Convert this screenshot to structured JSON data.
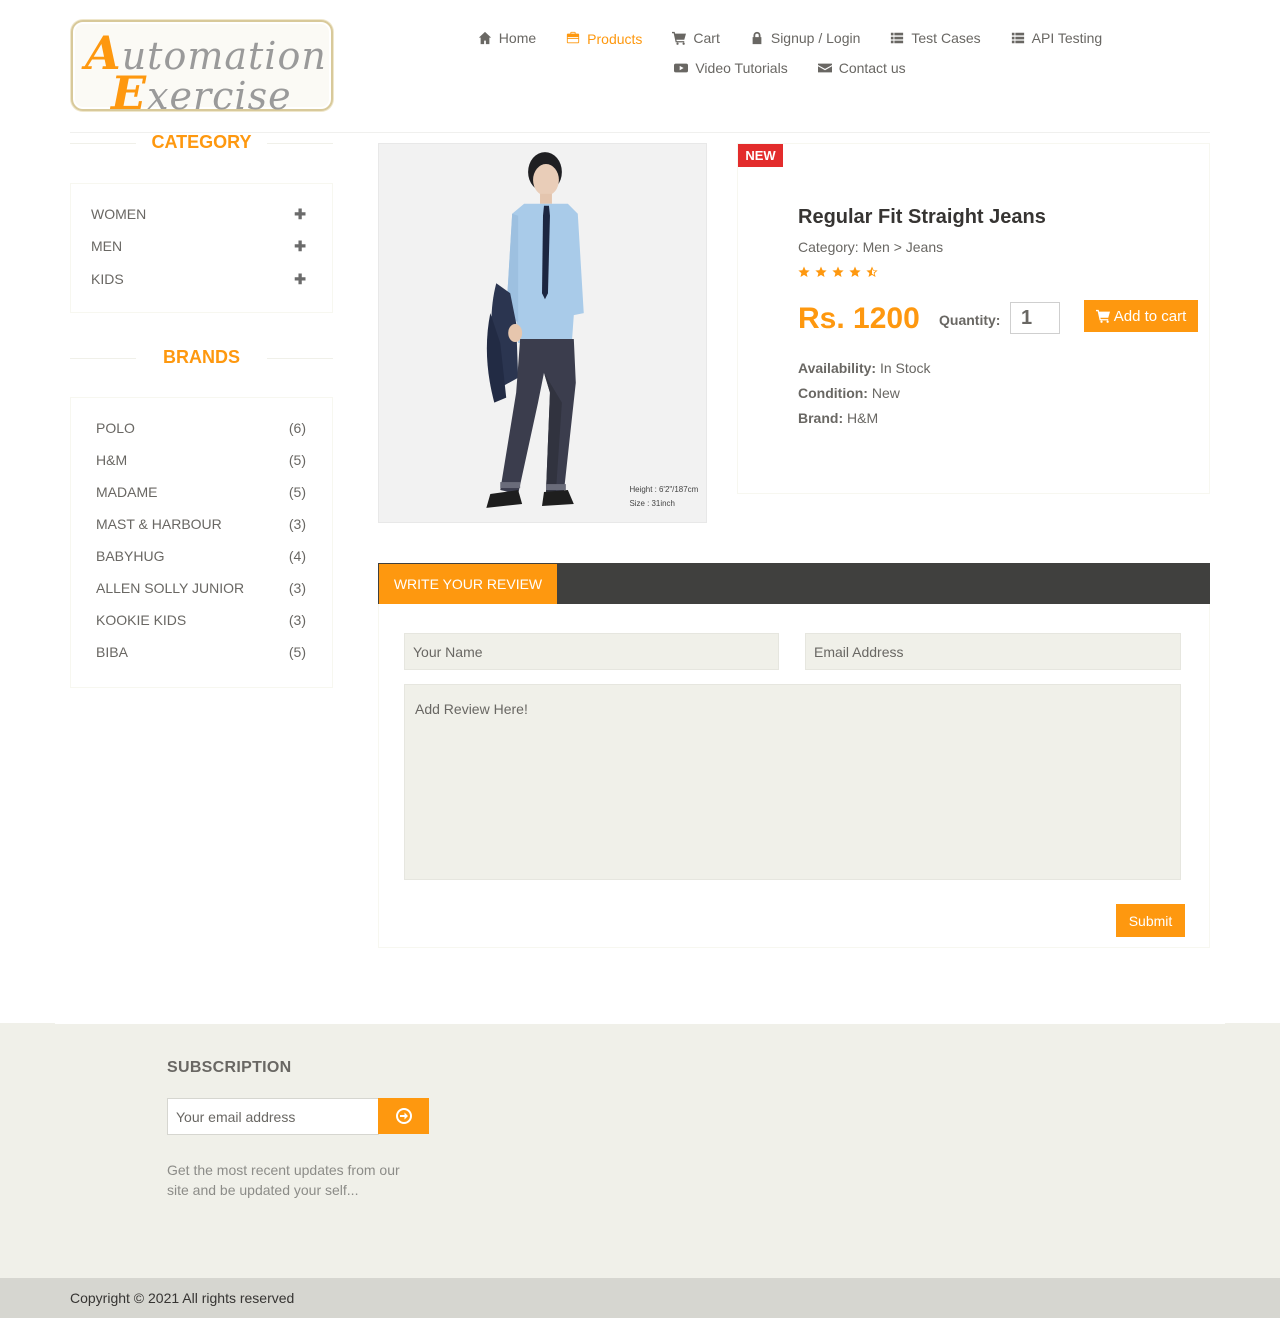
{
  "header": {
    "logo_text": "Automation Exercise",
    "nav_items": [
      {
        "label": "Home",
        "icon": "home-icon"
      },
      {
        "label": "Products",
        "icon": "briefcase-icon",
        "active": true
      },
      {
        "label": "Cart",
        "icon": "cart-icon"
      },
      {
        "label": "Signup / Login",
        "icon": "lock-icon"
      },
      {
        "label": "Test Cases",
        "icon": "list-icon"
      },
      {
        "label": "API Testing",
        "icon": "list-icon"
      },
      {
        "label": "Video Tutorials",
        "icon": "youtube-icon"
      },
      {
        "label": "Contact us",
        "icon": "envelope-icon"
      }
    ]
  },
  "sidebar": {
    "category_title": "CATEGORY",
    "categories": [
      {
        "label": "WOMEN",
        "icon": "plus-icon"
      },
      {
        "label": "MEN",
        "icon": "plus-icon"
      },
      {
        "label": "KIDS",
        "icon": "plus-icon"
      }
    ],
    "brands_title": "BRANDS",
    "brands": [
      {
        "name": "POLO",
        "count": "(6)"
      },
      {
        "name": "H&M",
        "count": "(5)"
      },
      {
        "name": "MADAME",
        "count": "(5)"
      },
      {
        "name": "MAST & HARBOUR",
        "count": "(3)"
      },
      {
        "name": "BABYHUG",
        "count": "(4)"
      },
      {
        "name": "ALLEN SOLLY JUNIOR",
        "count": "(3)"
      },
      {
        "name": "KOOKIE KIDS",
        "count": "(3)"
      },
      {
        "name": "BIBA",
        "count": "(5)"
      }
    ]
  },
  "product": {
    "badge": "NEW",
    "name": "Regular Fit Straight Jeans",
    "category": "Category: Men > Jeans",
    "rating": 4.5,
    "price": "Rs. 1200",
    "quantity_label": "Quantity:",
    "quantity_value": "1",
    "add_to_cart_label": "Add to cart",
    "availability_label": "Availability:",
    "availability_value": "In Stock",
    "condition_label": "Condition:",
    "condition_value": "New",
    "brand_label": "Brand:",
    "brand_value": "H&M",
    "image_caption_line1": "Height : 6'2\"/187cm",
    "image_caption_line2": "Size : 31inch"
  },
  "review": {
    "tab_label": "WRITE YOUR REVIEW",
    "name_placeholder": "Your Name",
    "email_placeholder": "Email Address",
    "review_placeholder": "Add Review Here!",
    "submit_label": "Submit"
  },
  "footer": {
    "subscription_title": "SUBSCRIPTION",
    "email_placeholder": "Your email address",
    "description": "Get the most recent updates from our site and be updated your self...",
    "copyright": "Copyright © 2021 All rights reserved"
  },
  "colors": {
    "accent": "#FE980F",
    "badge": "#E32C2C",
    "footer_bg": "#F0F0E9",
    "bottom_bar": "#D6D6D0",
    "review_bar": "#40403E"
  }
}
